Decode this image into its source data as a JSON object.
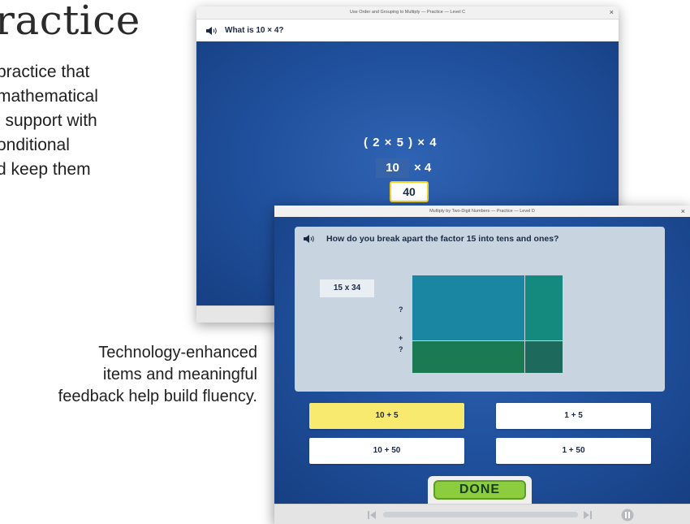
{
  "left_text": {
    "heading": "ractice",
    "intro_lines": [
      "practice that",
      " mathematical",
      "l support with",
      "onditional",
      "d keep them"
    ],
    "caption_lines": [
      "Technology-enhanced",
      "items and meaningful",
      "feedback help build fluency."
    ]
  },
  "window1": {
    "title": "Use Order and Grouping to Multiply — Practice — Level C",
    "close_symbol": "×",
    "question": "What is 10 × 4?",
    "expression": "( 2 × 5 ) × 4",
    "step_value": "10",
    "step_rest": "× 4",
    "answer": "40",
    "icons": [
      "speaker-icon",
      "close-icon"
    ]
  },
  "window2": {
    "title": "Multiply by Two-Digit Numbers — Practice — Level D",
    "close_symbol": "×",
    "question": "How do you break apart the factor 15 into tens and ones?",
    "factor_label": "15 x 34",
    "unknown_top": "?",
    "plus": "+",
    "unknown_bottom": "?",
    "area_model_colors": {
      "top_left": "#1b86a1",
      "top_right": "#148a7e",
      "bottom_left": "#1b7a52",
      "bottom_right": "#1d6a5c"
    },
    "options": [
      {
        "label": "10 + 5",
        "selected": true
      },
      {
        "label": "1 + 5",
        "selected": false
      },
      {
        "label": "10 + 50",
        "selected": false
      },
      {
        "label": "1 + 50",
        "selected": false
      }
    ],
    "done_label": "DONE",
    "icons": [
      "speaker-icon",
      "close-icon",
      "previous-icon",
      "next-icon",
      "pause-icon"
    ]
  },
  "colors": {
    "stage_blue": "#1f4f9b",
    "selected_option": "#f8ea6e",
    "done_green": "#8ccc3f",
    "answer_border": "#f4d21e"
  }
}
